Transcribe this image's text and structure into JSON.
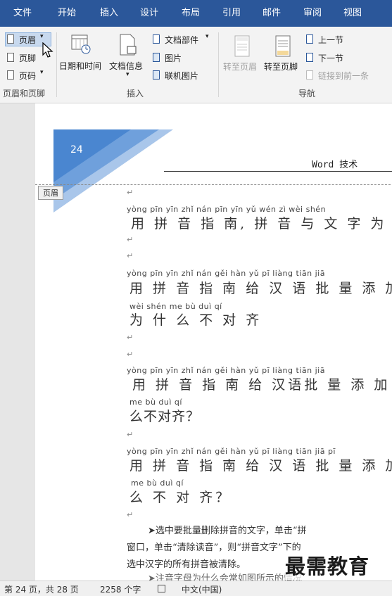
{
  "menu": [
    "文件",
    "开始",
    "插入",
    "设计",
    "布局",
    "引用",
    "邮件",
    "审阅",
    "视图"
  ],
  "ribbon": {
    "header_btn": "页眉",
    "footer_btn": "页脚",
    "pagenum_btn": "页码",
    "group1": "页眉和页脚",
    "datetime_btn": "日期和时间",
    "docinfo_btn": "文档信息",
    "docparts_btn": "文档部件",
    "picture_btn": "图片",
    "online_picture_btn": "联机图片",
    "group2": "插入",
    "goto_header_btn": "转至页眉",
    "goto_footer_btn": "转至页脚",
    "prev_section_btn": "上一节",
    "next_section_btn": "下一节",
    "link_prev_btn": "链接到前一条",
    "group3": "导航"
  },
  "doc": {
    "page_number": "24",
    "header_text": "Word 技术",
    "header_tag": "页眉",
    "lines": {
      "p1": "yòng pīn yīn zhǐ nán   pīn yīn yǔ wén zì wèi shén",
      "h1": "用 拼 音 指 南, 拼 音 与 文 字 为 什",
      "p2": "yòng pīn yīn zhǐ nán gěi hàn yǔ  pī liàng tiān jiā",
      "h2": "用 拼 音 指 南 给 汉 语 批 量  添  加",
      "p3": "wèi shén me  bù  duì  qí",
      "h3": "为 什 么 不 对 齐",
      "p4": "yòng pīn yīn zhǐ nán gěi hàn yǔ pī liàng tiān jiā",
      "h4": "用 拼 音 指 南 给 汉语批 量  添  加",
      "p5": "me bù duì qí",
      "h5": "么不对齐？",
      "p6": "yòng pīn yīn zhǐ nán gěi hàn  yǔ  pī  liàng tiān jiā pī",
      "h6": "用 拼 音 指 南 给 汉 语 批  量  添 加 拼",
      "p7": "me  bù  duì  qí",
      "h7": "么 不 对 齐？",
      "b1": "➤选中要批量删除拼音的文字，单击“拼",
      "b2": "窗口，单击“清除读音”，则“拼音文字”下的",
      "b3": "选中汉字的所有拼音被清除。",
      "b4": "➤注音字母为什么会常如图所示的情况"
    },
    "watermark": "最需教育"
  },
  "status": {
    "page": "第 24 页，共 28 页",
    "words": "2258 个字",
    "lang": "中文(中国)"
  }
}
